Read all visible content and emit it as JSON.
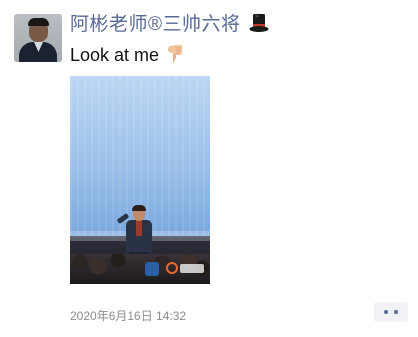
{
  "post": {
    "nickname": "阿彬老师®三帅六将",
    "nickname_emoji": "top-hat-icon",
    "text": "Look at me",
    "text_emoji": "backhand-index-pointing-down-icon",
    "timestamp": "2020年6月16日 14:32",
    "more_icon": "more-dots-icon"
  },
  "colors": {
    "nickname": "#576b95",
    "text": "#111111",
    "timestamp": "#8c8c8c",
    "more_button_bg": "#f1f2f5"
  }
}
